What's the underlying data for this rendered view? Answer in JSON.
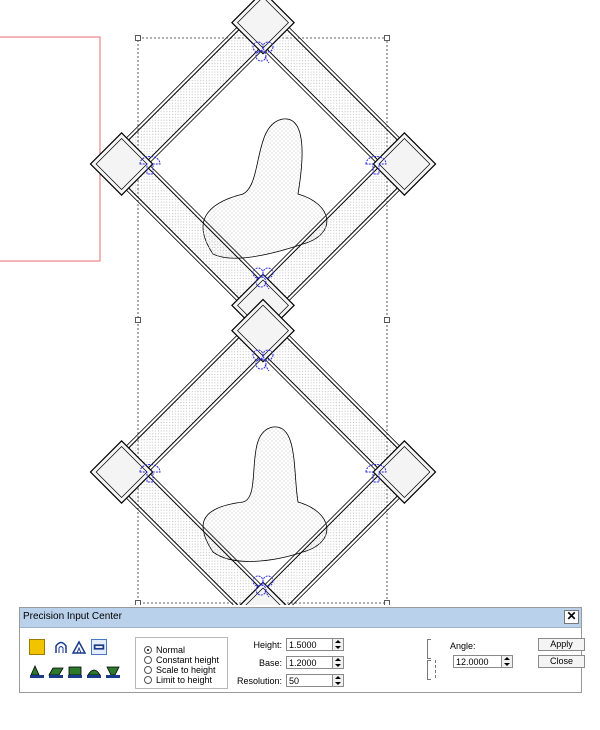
{
  "colors": {
    "stitch_outline": "#000000",
    "applique_blue": "#2b2bd6",
    "fill_dots": "#bcbcbc",
    "selection_box": "#ff6666",
    "titlebar": "#b9d1ea",
    "swatch": "#f2c400"
  },
  "dialog": {
    "title": "Precision Input Center",
    "close_glyph": "✕",
    "mode_options": [
      {
        "label": "Normal",
        "selected": true
      },
      {
        "label": "Constant height",
        "selected": false
      },
      {
        "label": "Scale to height",
        "selected": false
      },
      {
        "label": "Limit to height",
        "selected": false
      }
    ],
    "height_label": "Height:",
    "height_value": "1.5000",
    "base_label": "Base:",
    "base_value": "1.2000",
    "resolution_label": "Resolution:",
    "resolution_value": "50",
    "angle_label": "Angle:",
    "angle_value": "12.0000",
    "apply_label": "Apply",
    "close_label": "Close",
    "toolbar_icons": [
      "color-swatch-icon",
      "arch-up-icon",
      "peak-icon",
      "rectangle-text-icon",
      "shape-a-icon",
      "shape-b-icon",
      "shape-c-icon",
      "shape-d-icon",
      "shape-e-icon"
    ]
  }
}
